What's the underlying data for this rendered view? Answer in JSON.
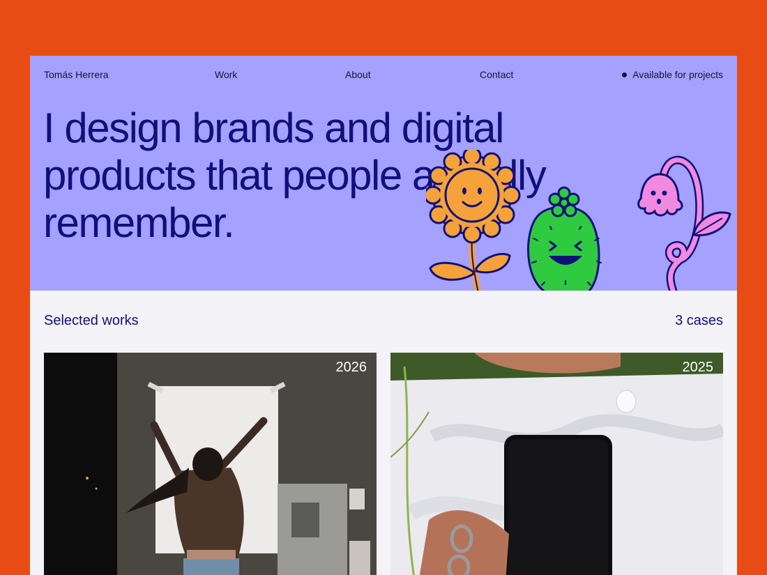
{
  "nav": {
    "brand": "Tomás Herrera",
    "links": [
      {
        "label": "Work"
      },
      {
        "label": "About"
      },
      {
        "label": "Contact"
      }
    ],
    "availability": "Available for projects"
  },
  "hero": {
    "headline": "I design brands and digital products that people actually remember.",
    "illustrations": [
      "sunflower-icon",
      "cactus-icon",
      "bellflower-icon"
    ]
  },
  "works": {
    "title": "Selected works",
    "count": "3 cases",
    "items": [
      {
        "year": "2026",
        "image": "person-poster-photo"
      },
      {
        "year": "2025",
        "image": "phone-on-shirt-photo"
      }
    ]
  },
  "colors": {
    "page_background": "#e84c14",
    "hero_background": "#a5a1ff",
    "accent_text": "#10107a",
    "content_background": "#f3f3f8"
  }
}
